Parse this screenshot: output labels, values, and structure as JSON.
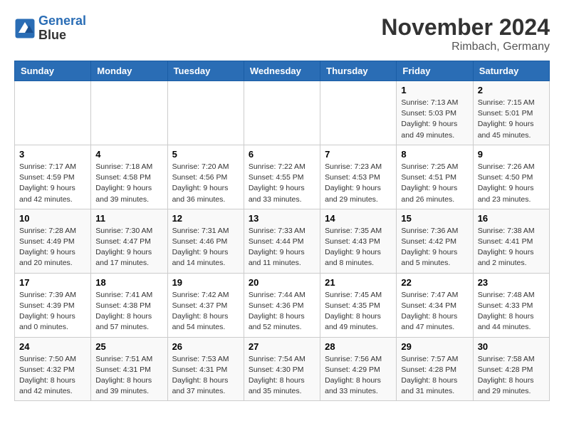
{
  "header": {
    "logo_line1": "General",
    "logo_line2": "Blue",
    "month_year": "November 2024",
    "location": "Rimbach, Germany"
  },
  "weekdays": [
    "Sunday",
    "Monday",
    "Tuesday",
    "Wednesday",
    "Thursday",
    "Friday",
    "Saturday"
  ],
  "weeks": [
    [
      {
        "day": "",
        "info": ""
      },
      {
        "day": "",
        "info": ""
      },
      {
        "day": "",
        "info": ""
      },
      {
        "day": "",
        "info": ""
      },
      {
        "day": "",
        "info": ""
      },
      {
        "day": "1",
        "info": "Sunrise: 7:13 AM\nSunset: 5:03 PM\nDaylight: 9 hours\nand 49 minutes."
      },
      {
        "day": "2",
        "info": "Sunrise: 7:15 AM\nSunset: 5:01 PM\nDaylight: 9 hours\nand 45 minutes."
      }
    ],
    [
      {
        "day": "3",
        "info": "Sunrise: 7:17 AM\nSunset: 4:59 PM\nDaylight: 9 hours\nand 42 minutes."
      },
      {
        "day": "4",
        "info": "Sunrise: 7:18 AM\nSunset: 4:58 PM\nDaylight: 9 hours\nand 39 minutes."
      },
      {
        "day": "5",
        "info": "Sunrise: 7:20 AM\nSunset: 4:56 PM\nDaylight: 9 hours\nand 36 minutes."
      },
      {
        "day": "6",
        "info": "Sunrise: 7:22 AM\nSunset: 4:55 PM\nDaylight: 9 hours\nand 33 minutes."
      },
      {
        "day": "7",
        "info": "Sunrise: 7:23 AM\nSunset: 4:53 PM\nDaylight: 9 hours\nand 29 minutes."
      },
      {
        "day": "8",
        "info": "Sunrise: 7:25 AM\nSunset: 4:51 PM\nDaylight: 9 hours\nand 26 minutes."
      },
      {
        "day": "9",
        "info": "Sunrise: 7:26 AM\nSunset: 4:50 PM\nDaylight: 9 hours\nand 23 minutes."
      }
    ],
    [
      {
        "day": "10",
        "info": "Sunrise: 7:28 AM\nSunset: 4:49 PM\nDaylight: 9 hours\nand 20 minutes."
      },
      {
        "day": "11",
        "info": "Sunrise: 7:30 AM\nSunset: 4:47 PM\nDaylight: 9 hours\nand 17 minutes."
      },
      {
        "day": "12",
        "info": "Sunrise: 7:31 AM\nSunset: 4:46 PM\nDaylight: 9 hours\nand 14 minutes."
      },
      {
        "day": "13",
        "info": "Sunrise: 7:33 AM\nSunset: 4:44 PM\nDaylight: 9 hours\nand 11 minutes."
      },
      {
        "day": "14",
        "info": "Sunrise: 7:35 AM\nSunset: 4:43 PM\nDaylight: 9 hours\nand 8 minutes."
      },
      {
        "day": "15",
        "info": "Sunrise: 7:36 AM\nSunset: 4:42 PM\nDaylight: 9 hours\nand 5 minutes."
      },
      {
        "day": "16",
        "info": "Sunrise: 7:38 AM\nSunset: 4:41 PM\nDaylight: 9 hours\nand 2 minutes."
      }
    ],
    [
      {
        "day": "17",
        "info": "Sunrise: 7:39 AM\nSunset: 4:39 PM\nDaylight: 9 hours\nand 0 minutes."
      },
      {
        "day": "18",
        "info": "Sunrise: 7:41 AM\nSunset: 4:38 PM\nDaylight: 8 hours\nand 57 minutes."
      },
      {
        "day": "19",
        "info": "Sunrise: 7:42 AM\nSunset: 4:37 PM\nDaylight: 8 hours\nand 54 minutes."
      },
      {
        "day": "20",
        "info": "Sunrise: 7:44 AM\nSunset: 4:36 PM\nDaylight: 8 hours\nand 52 minutes."
      },
      {
        "day": "21",
        "info": "Sunrise: 7:45 AM\nSunset: 4:35 PM\nDaylight: 8 hours\nand 49 minutes."
      },
      {
        "day": "22",
        "info": "Sunrise: 7:47 AM\nSunset: 4:34 PM\nDaylight: 8 hours\nand 47 minutes."
      },
      {
        "day": "23",
        "info": "Sunrise: 7:48 AM\nSunset: 4:33 PM\nDaylight: 8 hours\nand 44 minutes."
      }
    ],
    [
      {
        "day": "24",
        "info": "Sunrise: 7:50 AM\nSunset: 4:32 PM\nDaylight: 8 hours\nand 42 minutes."
      },
      {
        "day": "25",
        "info": "Sunrise: 7:51 AM\nSunset: 4:31 PM\nDaylight: 8 hours\nand 39 minutes."
      },
      {
        "day": "26",
        "info": "Sunrise: 7:53 AM\nSunset: 4:31 PM\nDaylight: 8 hours\nand 37 minutes."
      },
      {
        "day": "27",
        "info": "Sunrise: 7:54 AM\nSunset: 4:30 PM\nDaylight: 8 hours\nand 35 minutes."
      },
      {
        "day": "28",
        "info": "Sunrise: 7:56 AM\nSunset: 4:29 PM\nDaylight: 8 hours\nand 33 minutes."
      },
      {
        "day": "29",
        "info": "Sunrise: 7:57 AM\nSunset: 4:28 PM\nDaylight: 8 hours\nand 31 minutes."
      },
      {
        "day": "30",
        "info": "Sunrise: 7:58 AM\nSunset: 4:28 PM\nDaylight: 8 hours\nand 29 minutes."
      }
    ]
  ]
}
